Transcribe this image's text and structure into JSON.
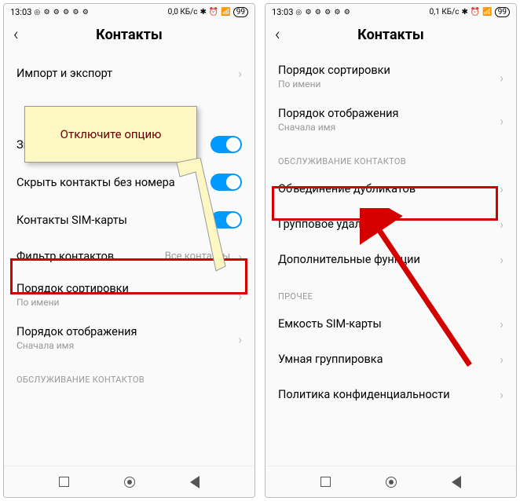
{
  "left": {
    "status": {
      "time": "13:03",
      "net": "0,0 КБ/с",
      "battery": "99"
    },
    "title": "Контакты",
    "rows": {
      "import": "Импорт и экспорт",
      "photos": "Значки для контактов без фото",
      "hide": "Скрыть контакты без номера",
      "sim": "Контакты SIM-карты",
      "filter": "Фильтр контактов",
      "filter_val": "Все контакты",
      "sort": "Порядок сортировки",
      "sort_sub": "По имени",
      "display": "Порядок отображения",
      "display_sub": "Сначала имя",
      "section": "ОБСЛУЖИВАНИЕ КОНТАКТОВ"
    },
    "callout": "Отключите опцию"
  },
  "right": {
    "status": {
      "time": "13:03",
      "net": "0,1 КБ/с",
      "battery": "99"
    },
    "title": "Контакты",
    "rows": {
      "sort": "Порядок сортировки",
      "sort_sub": "По имени",
      "display": "Порядок отображения",
      "display_sub": "Сначала имя",
      "sec_maint": "ОБСЛУЖИВАНИЕ КОНТАКТОВ",
      "merge": "Объединение дубликатов",
      "bulkdel": "Групповое удаление",
      "more": "Дополнительные функции",
      "sec_other": "ПРОЧЕЕ",
      "capacity": "Емкость SIM-карты",
      "smart": "Умная группировка",
      "privacy": "Политика конфиденциальности"
    }
  }
}
